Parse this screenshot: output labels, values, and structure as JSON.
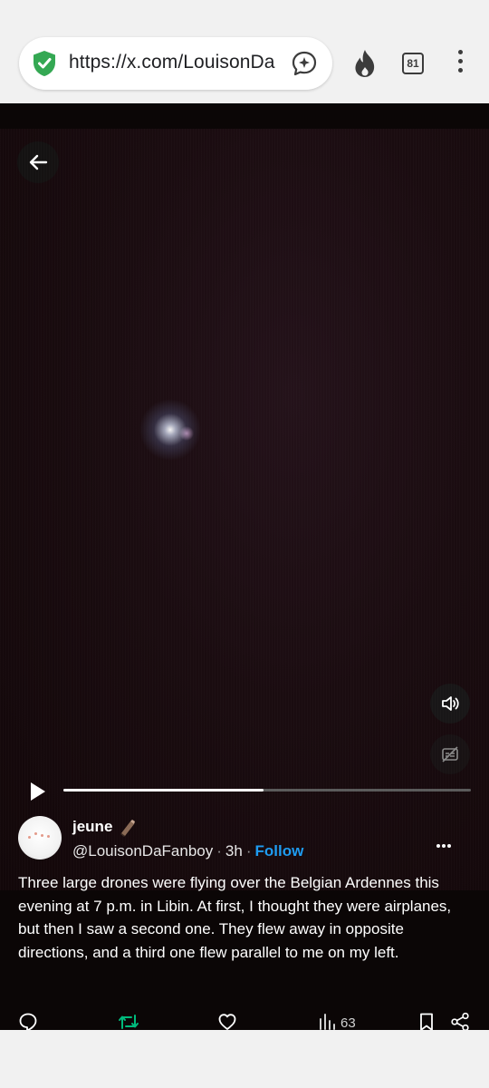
{
  "browser": {
    "url": "https://x.com/LouisonDa",
    "tab_count": "81",
    "icons": {
      "security": "shield-check-icon",
      "assistant": "sparkle-chat-icon",
      "fire": "fire-icon",
      "menu": "more-vertical-icon"
    },
    "colors": {
      "shield": "#34a853",
      "toolbar_background": "#f1f1f1"
    }
  },
  "media": {
    "icons": {
      "back": "arrow-left-icon",
      "volume": "volume-icon",
      "captions": "captions-off-icon",
      "play": "play-icon"
    },
    "progress": 0.49
  },
  "tweet": {
    "display_name": "jeune",
    "name_emoji": "writing-hand-emoji",
    "handle": "@LouisonDaFanboy",
    "separator": "·",
    "time": "3h",
    "follow_label": "Follow",
    "text": "Three large drones were flying over the Belgian Ardennes this evening at 7 p.m. in Libin. At first, I thought they were airplanes, but then I saw a second one. They flew away in opposite directions, and a third one flew parallel to me on my left.",
    "views_count": "63",
    "colors": {
      "follow": "#1d9bf0",
      "repost": "#00ba7c"
    },
    "icons": {
      "more": "more-horizontal-icon",
      "reply": "reply-icon",
      "repost": "repost-icon",
      "like": "heart-icon",
      "views": "views-chart-icon",
      "bookmark": "bookmark-icon",
      "share": "share-icon"
    }
  }
}
